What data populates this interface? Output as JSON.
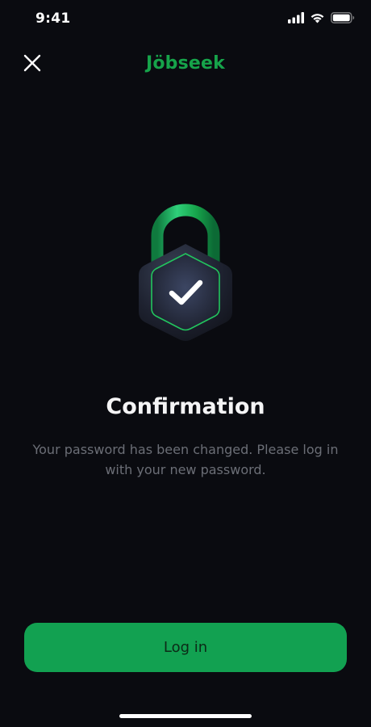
{
  "status_bar": {
    "time": "9:41",
    "icons": [
      "cellular-signal-icon",
      "wifi-icon",
      "battery-icon"
    ]
  },
  "header": {
    "close_icon": "close-icon",
    "app_name": "Jöbseek"
  },
  "illustration": {
    "icon": "padlock-check-icon"
  },
  "content": {
    "title": "Confirmation",
    "message": "Your password has been changed. Please log in with your new password."
  },
  "actions": {
    "login_label": "Log in"
  },
  "colors": {
    "background": "#0a0b10",
    "brand_green": "#16a34a",
    "button_green": "#12a151",
    "muted_text": "#6b6e76"
  }
}
